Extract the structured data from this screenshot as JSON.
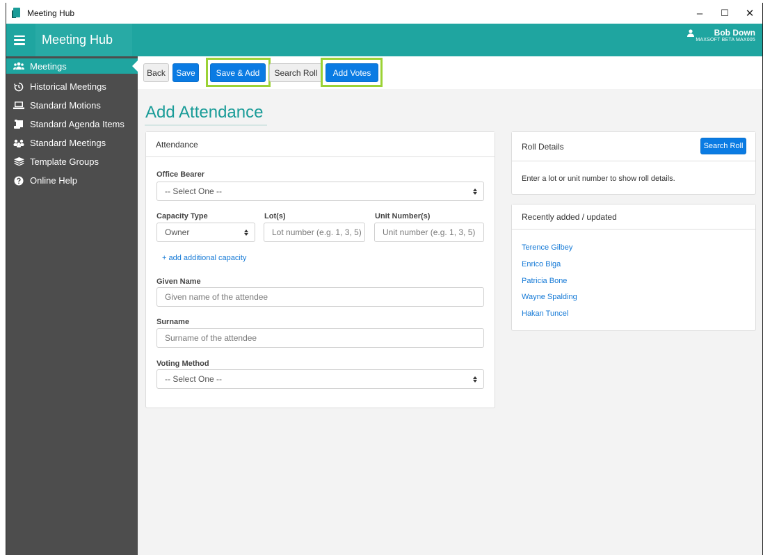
{
  "window": {
    "title": "Meeting Hub",
    "controls": {
      "minimize": "–",
      "maximize": "☐",
      "close": "✕"
    }
  },
  "brand": {
    "title": "Meeting Hub"
  },
  "user": {
    "name": "Bob Down",
    "org": "MAXSOFT BETA MAX005"
  },
  "sidebar": {
    "items": [
      {
        "label": "Meetings",
        "icon": "people-icon"
      },
      {
        "label": "Historical Meetings",
        "icon": "history-icon"
      },
      {
        "label": "Standard Motions",
        "icon": "monitor-icon"
      },
      {
        "label": "Standard Agenda Items",
        "icon": "scroll-icon"
      },
      {
        "label": "Standard Meetings",
        "icon": "meeting-icon"
      },
      {
        "label": "Template Groups",
        "icon": "layers-icon"
      },
      {
        "label": "Online Help",
        "icon": "help-icon"
      }
    ]
  },
  "toolbar": {
    "back": "Back",
    "save": "Save",
    "save_add": "Save & Add",
    "search_roll": "Search Roll",
    "add_votes": "Add Votes"
  },
  "page": {
    "title": "Add Attendance"
  },
  "attendance": {
    "heading": "Attendance",
    "office_bearer_label": "Office Bearer",
    "office_bearer_value": "-- Select One --",
    "capacity_label": "Capacity Type",
    "capacity_value": "Owner",
    "lots_label": "Lot(s)",
    "lots_placeholder": "Lot number (e.g. 1, 3, 5)",
    "units_label": "Unit Number(s)",
    "units_placeholder": "Unit number (e.g. 1, 3, 5)",
    "add_capacity": "+ add additional capacity",
    "given_label": "Given Name",
    "given_placeholder": "Given name of the attendee",
    "surname_label": "Surname",
    "surname_placeholder": "Surname of the attendee",
    "voting_label": "Voting Method",
    "voting_value": "-- Select One --"
  },
  "roll": {
    "heading": "Roll Details",
    "search_button": "Search Roll",
    "message": "Enter a lot or unit number to show roll details."
  },
  "recent": {
    "heading": "Recently added / updated",
    "names": [
      "Terence Gilbey",
      "Enrico Biga",
      "Patricia Bone",
      "Wayne Spalding",
      "Hakan Tuncel"
    ]
  },
  "colors": {
    "teal": "#1fa5a0",
    "sidebar": "#4d4d4d",
    "primary": "#0a7be3",
    "highlight": "#9bd235"
  }
}
